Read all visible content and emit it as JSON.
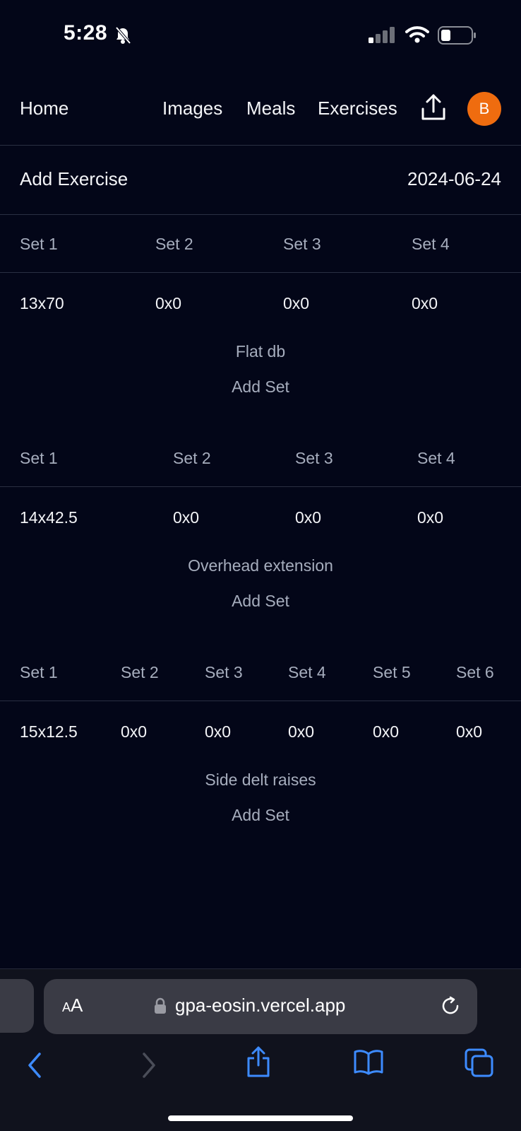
{
  "status_bar": {
    "time": "5:28"
  },
  "nav": {
    "home": "Home",
    "images": "Images",
    "meals": "Meals",
    "exercises": "Exercises",
    "avatar_letter": "B"
  },
  "header": {
    "add_exercise": "Add Exercise",
    "date": "2024-06-24"
  },
  "exercises": [
    {
      "name": "Flat db",
      "add_set": "Add Set",
      "set_labels": [
        "Set 1",
        "Set 2",
        "Set 3",
        "Set 4"
      ],
      "set_values": [
        "13x70",
        "0x0",
        "0x0",
        "0x0"
      ]
    },
    {
      "name": "Overhead extension",
      "add_set": "Add Set",
      "set_labels": [
        "Set 1",
        "Set 2",
        "Set 3",
        "Set 4"
      ],
      "set_values": [
        "14x42.5",
        "0x0",
        "0x0",
        "0x0"
      ]
    },
    {
      "name": "Side delt raises",
      "add_set": "Add Set",
      "set_labels": [
        "Set 1",
        "Set 2",
        "Set 3",
        "Set 4",
        "Set 5",
        "Set 6"
      ],
      "set_values": [
        "15x12.5",
        "0x0",
        "0x0",
        "0x0",
        "0x0",
        "0x0"
      ]
    }
  ],
  "browser": {
    "aa_label_small": "A",
    "aa_label_large": "A",
    "url": "gpa-eosin.vercel.app"
  },
  "colors": {
    "background": "#030618",
    "avatar": "#ef6c0f",
    "toolbar_accent": "#3d8bff"
  }
}
